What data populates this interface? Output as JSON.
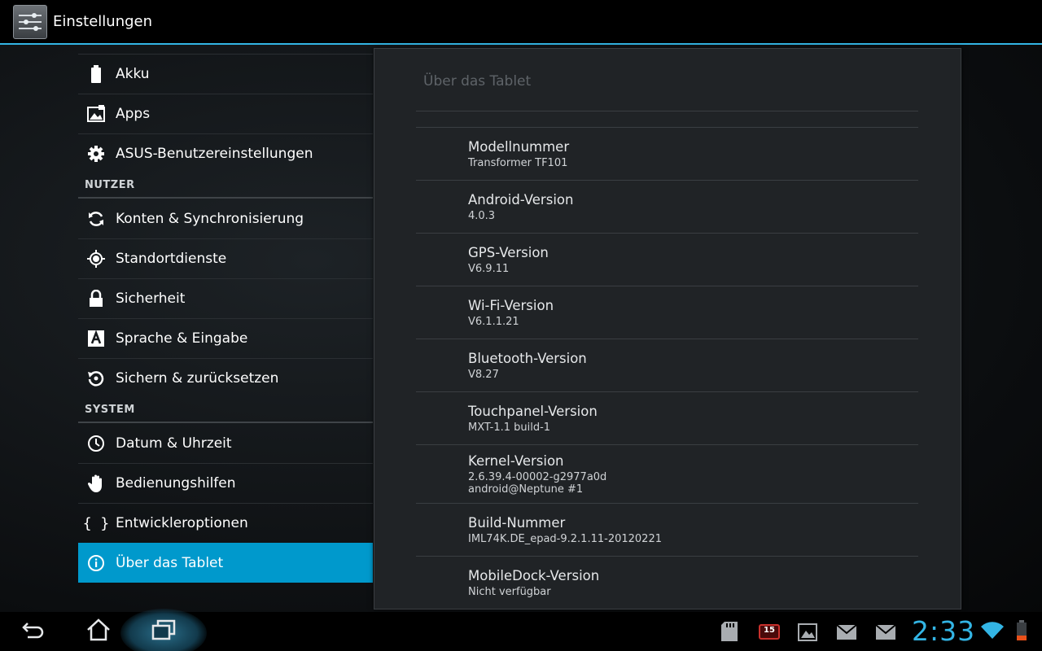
{
  "action_bar": {
    "title": "Einstellungen",
    "icon": "settings-sliders-icon"
  },
  "left_list": {
    "items_top": [
      {
        "label": "Akku",
        "icon": "battery-icon"
      },
      {
        "label": "Apps",
        "icon": "apps-icon"
      },
      {
        "label": "ASUS-Benutzereinstellungen",
        "icon": "gear-icon"
      }
    ],
    "section_user": "NUTZER",
    "items_user": [
      {
        "label": "Konten & Synchronisierung",
        "icon": "sync-icon"
      },
      {
        "label": "Standortdienste",
        "icon": "location-icon"
      },
      {
        "label": "Sicherheit",
        "icon": "lock-icon"
      },
      {
        "label": "Sprache & Eingabe",
        "icon": "language-icon"
      },
      {
        "label": "Sichern & zurücksetzen",
        "icon": "backup-icon"
      }
    ],
    "section_system": "SYSTEM",
    "items_system": [
      {
        "label": "Datum & Uhrzeit",
        "icon": "clock-icon"
      },
      {
        "label": "Bedienungshilfen",
        "icon": "hand-icon"
      },
      {
        "label": "Entwickleroptionen",
        "icon": "braces-icon",
        "glyph": "{ }"
      },
      {
        "label": "Über das Tablet",
        "icon": "info-icon",
        "selected": true
      }
    ]
  },
  "panel": {
    "title": "Über das Tablet",
    "items": [
      {
        "title": "Modellnummer",
        "value": "Transformer TF101"
      },
      {
        "title": "Android-Version",
        "value": "4.0.3"
      },
      {
        "title": "GPS-Version",
        "value": "V6.9.11"
      },
      {
        "title": "Wi-Fi-Version",
        "value": "V6.1.1.21"
      },
      {
        "title": "Bluetooth-Version",
        "value": "V8.27"
      },
      {
        "title": "Touchpanel-Version",
        "value": "MXT-1.1 build-1"
      },
      {
        "title": "Kernel-Version",
        "value": "2.6.39.4-00002-g2977a0d",
        "value2": "android@Neptune #1"
      },
      {
        "title": "Build-Nummer",
        "value": "IML74K.DE_epad-9.2.1.11-20120221"
      },
      {
        "title": "MobileDock-Version",
        "value": "Nicht verfügbar"
      }
    ]
  },
  "nav_bar": {
    "back_icon": "back-icon",
    "home_icon": "home-icon",
    "recents_icon": "recent-apps-icon",
    "calendar_badge": "15",
    "clock": "2:33",
    "status_icons": [
      "sd-card-icon",
      "calendar-icon",
      "gallery-icon",
      "mail-icon",
      "mail-icon",
      "wifi-icon",
      "battery-low-icon"
    ]
  },
  "colors": {
    "accent": "#33b5e5",
    "selected": "#0099cc",
    "battery_low": "#e8501a"
  }
}
